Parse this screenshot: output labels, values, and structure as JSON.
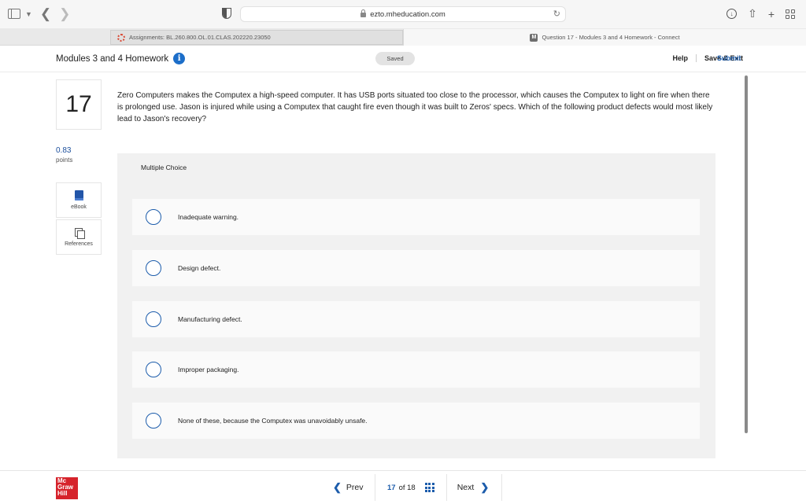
{
  "browser": {
    "url": "ezto.mheducation.com",
    "tabs": [
      {
        "label": "Assignments: BL.260.800.OL.01.CLAS.202220.23050",
        "active": true,
        "icon": "spinner-icon"
      },
      {
        "label": "Question 17 - Modules 3 and 4 Homework - Connect",
        "active": false,
        "icon": "m-icon"
      }
    ]
  },
  "header": {
    "title": "Modules 3 and 4 Homework",
    "saved_label": "Saved",
    "help_label": "Help",
    "save_exit_label": "Save & Exit",
    "submit_label": "Submit"
  },
  "question": {
    "number": "17",
    "points_value": "0.83",
    "points_label": "points",
    "ebook_label": "eBook",
    "references_label": "References",
    "text": "Zero Computers makes the Computex a high-speed computer. It has USB ports situated too close to the processor, which causes the Computex to light on fire when there is prolonged use. Jason is injured while using a Computex that caught fire even though it was built to Zeros' specs. Which of the following product defects would most likely lead to Jason's recovery?",
    "type_label": "Multiple Choice",
    "options": [
      "Inadequate warning.",
      "Design defect.",
      "Manufacturing defect.",
      "Improper packaging.",
      "None of these, because the Computex was unavoidably unsafe."
    ]
  },
  "footer": {
    "logo_lines": [
      "Mc",
      "Graw",
      "Hill"
    ],
    "prev_label": "Prev",
    "current_page": "17",
    "of_label": "of 18",
    "next_label": "Next"
  },
  "colors": {
    "accent": "#1c5cab",
    "brand_red": "#d6232b"
  }
}
